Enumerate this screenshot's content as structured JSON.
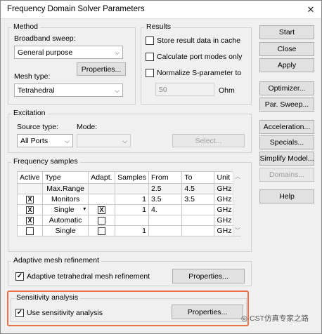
{
  "window": {
    "title": "Frequency Domain Solver Parameters",
    "close_glyph": "✕"
  },
  "method": {
    "group_label": "Method",
    "broadband_label": "Broadband sweep:",
    "broadband_value": "General purpose",
    "properties_label": "Properties...",
    "mesh_label": "Mesh type:",
    "mesh_value": "Tetrahedral"
  },
  "results": {
    "group_label": "Results",
    "store_label": "Store result data in cache",
    "port_modes_label": "Calculate port modes only",
    "normalize_label": "Normalize S-parameter to",
    "normalize_value": "50",
    "unit": "Ohm"
  },
  "excitation": {
    "group_label": "Excitation",
    "source_label": "Source type:",
    "source_value": "All Ports",
    "mode_label": "Mode:",
    "mode_value": "",
    "select_label": "Select..."
  },
  "frequency_samples": {
    "group_label": "Frequency samples",
    "headers": [
      "Active",
      "Type",
      "Adapt.",
      "Samples",
      "From",
      "To",
      "Unit"
    ],
    "rows": [
      {
        "active": "",
        "type": "Max.Range",
        "adapt": "",
        "samples": "",
        "from": "2.5",
        "to": "4.5",
        "unit": "GHz"
      },
      {
        "active": "X",
        "type": "Monitors",
        "adapt": "",
        "samples": "1",
        "from": "3.5",
        "to": "3.5",
        "unit": "GHz"
      },
      {
        "active": "X",
        "type": "Single",
        "adapt": "X",
        "samples": "1",
        "from": "4.",
        "to": "",
        "unit": "GHz"
      },
      {
        "active": "X",
        "type": "Automatic",
        "adapt": "",
        "samples": "",
        "from": "",
        "to": "",
        "unit": "GHz"
      },
      {
        "active": "",
        "type": "Single",
        "adapt": "",
        "samples": "1",
        "from": "",
        "to": "",
        "unit": "GHz"
      }
    ]
  },
  "adaptive": {
    "group_label": "Adaptive mesh refinement",
    "checkbox_label": "Adaptive tetrahedral mesh refinement",
    "properties_label": "Properties..."
  },
  "sensitivity": {
    "group_label": "Sensitivity analysis",
    "checkbox_label": "Use sensitivity analysis",
    "properties_label": "Properties..."
  },
  "side_buttons": {
    "start": "Start",
    "close": "Close",
    "apply": "Apply",
    "optimizer": "Optimizer...",
    "par_sweep": "Par. Sweep...",
    "acceleration": "Acceleration...",
    "specials": "Specials...",
    "simplify": "Simplify Model...",
    "domains": "Domains...",
    "help": "Help"
  },
  "watermark": "CST仿真专家之路",
  "colors": {
    "highlight": "#e8714a",
    "window_bg": "#f0f0f0"
  }
}
